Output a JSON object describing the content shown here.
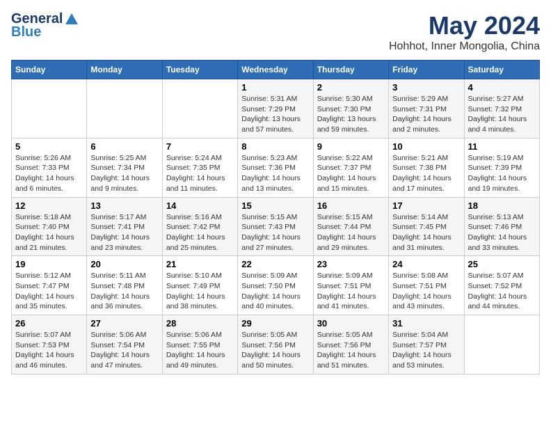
{
  "header": {
    "logo_general": "General",
    "logo_blue": "Blue",
    "title": "May 2024",
    "location": "Hohhot, Inner Mongolia, China"
  },
  "days_of_week": [
    "Sunday",
    "Monday",
    "Tuesday",
    "Wednesday",
    "Thursday",
    "Friday",
    "Saturday"
  ],
  "weeks": [
    [
      {
        "day": "",
        "info": ""
      },
      {
        "day": "",
        "info": ""
      },
      {
        "day": "",
        "info": ""
      },
      {
        "day": "1",
        "info": "Sunrise: 5:31 AM\nSunset: 7:29 PM\nDaylight: 13 hours and 57 minutes."
      },
      {
        "day": "2",
        "info": "Sunrise: 5:30 AM\nSunset: 7:30 PM\nDaylight: 13 hours and 59 minutes."
      },
      {
        "day": "3",
        "info": "Sunrise: 5:29 AM\nSunset: 7:31 PM\nDaylight: 14 hours and 2 minutes."
      },
      {
        "day": "4",
        "info": "Sunrise: 5:27 AM\nSunset: 7:32 PM\nDaylight: 14 hours and 4 minutes."
      }
    ],
    [
      {
        "day": "5",
        "info": "Sunrise: 5:26 AM\nSunset: 7:33 PM\nDaylight: 14 hours and 6 minutes."
      },
      {
        "day": "6",
        "info": "Sunrise: 5:25 AM\nSunset: 7:34 PM\nDaylight: 14 hours and 9 minutes."
      },
      {
        "day": "7",
        "info": "Sunrise: 5:24 AM\nSunset: 7:35 PM\nDaylight: 14 hours and 11 minutes."
      },
      {
        "day": "8",
        "info": "Sunrise: 5:23 AM\nSunset: 7:36 PM\nDaylight: 14 hours and 13 minutes."
      },
      {
        "day": "9",
        "info": "Sunrise: 5:22 AM\nSunset: 7:37 PM\nDaylight: 14 hours and 15 minutes."
      },
      {
        "day": "10",
        "info": "Sunrise: 5:21 AM\nSunset: 7:38 PM\nDaylight: 14 hours and 17 minutes."
      },
      {
        "day": "11",
        "info": "Sunrise: 5:19 AM\nSunset: 7:39 PM\nDaylight: 14 hours and 19 minutes."
      }
    ],
    [
      {
        "day": "12",
        "info": "Sunrise: 5:18 AM\nSunset: 7:40 PM\nDaylight: 14 hours and 21 minutes."
      },
      {
        "day": "13",
        "info": "Sunrise: 5:17 AM\nSunset: 7:41 PM\nDaylight: 14 hours and 23 minutes."
      },
      {
        "day": "14",
        "info": "Sunrise: 5:16 AM\nSunset: 7:42 PM\nDaylight: 14 hours and 25 minutes."
      },
      {
        "day": "15",
        "info": "Sunrise: 5:15 AM\nSunset: 7:43 PM\nDaylight: 14 hours and 27 minutes."
      },
      {
        "day": "16",
        "info": "Sunrise: 5:15 AM\nSunset: 7:44 PM\nDaylight: 14 hours and 29 minutes."
      },
      {
        "day": "17",
        "info": "Sunrise: 5:14 AM\nSunset: 7:45 PM\nDaylight: 14 hours and 31 minutes."
      },
      {
        "day": "18",
        "info": "Sunrise: 5:13 AM\nSunset: 7:46 PM\nDaylight: 14 hours and 33 minutes."
      }
    ],
    [
      {
        "day": "19",
        "info": "Sunrise: 5:12 AM\nSunset: 7:47 PM\nDaylight: 14 hours and 35 minutes."
      },
      {
        "day": "20",
        "info": "Sunrise: 5:11 AM\nSunset: 7:48 PM\nDaylight: 14 hours and 36 minutes."
      },
      {
        "day": "21",
        "info": "Sunrise: 5:10 AM\nSunset: 7:49 PM\nDaylight: 14 hours and 38 minutes."
      },
      {
        "day": "22",
        "info": "Sunrise: 5:09 AM\nSunset: 7:50 PM\nDaylight: 14 hours and 40 minutes."
      },
      {
        "day": "23",
        "info": "Sunrise: 5:09 AM\nSunset: 7:51 PM\nDaylight: 14 hours and 41 minutes."
      },
      {
        "day": "24",
        "info": "Sunrise: 5:08 AM\nSunset: 7:51 PM\nDaylight: 14 hours and 43 minutes."
      },
      {
        "day": "25",
        "info": "Sunrise: 5:07 AM\nSunset: 7:52 PM\nDaylight: 14 hours and 44 minutes."
      }
    ],
    [
      {
        "day": "26",
        "info": "Sunrise: 5:07 AM\nSunset: 7:53 PM\nDaylight: 14 hours and 46 minutes."
      },
      {
        "day": "27",
        "info": "Sunrise: 5:06 AM\nSunset: 7:54 PM\nDaylight: 14 hours and 47 minutes."
      },
      {
        "day": "28",
        "info": "Sunrise: 5:06 AM\nSunset: 7:55 PM\nDaylight: 14 hours and 49 minutes."
      },
      {
        "day": "29",
        "info": "Sunrise: 5:05 AM\nSunset: 7:56 PM\nDaylight: 14 hours and 50 minutes."
      },
      {
        "day": "30",
        "info": "Sunrise: 5:05 AM\nSunset: 7:56 PM\nDaylight: 14 hours and 51 minutes."
      },
      {
        "day": "31",
        "info": "Sunrise: 5:04 AM\nSunset: 7:57 PM\nDaylight: 14 hours and 53 minutes."
      },
      {
        "day": "",
        "info": ""
      }
    ]
  ]
}
